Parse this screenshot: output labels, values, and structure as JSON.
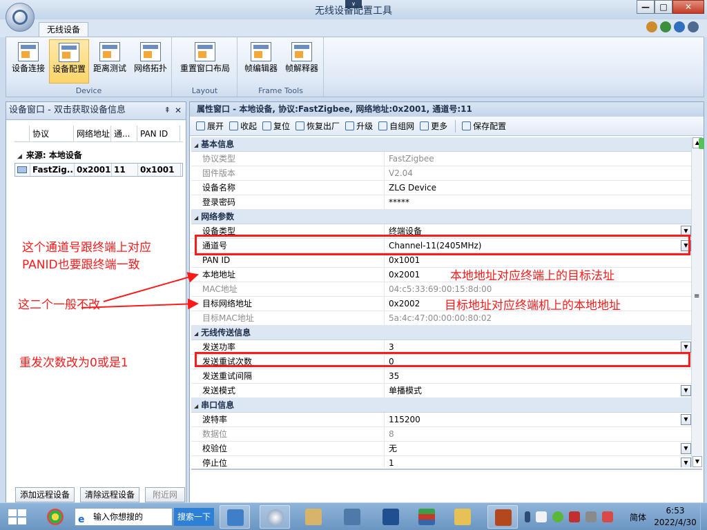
{
  "window": {
    "title": "无线设备配置工具",
    "min": "—",
    "max": "□",
    "close": "✕",
    "collapse": "∨"
  },
  "ribbon": {
    "tab": "无线设备",
    "groups": [
      {
        "label": "Device",
        "buttons": [
          "设备连接",
          "设备配置",
          "距离测试",
          "网络拓扑"
        ]
      },
      {
        "label": "Layout",
        "buttons": [
          "重置窗口布局"
        ]
      },
      {
        "label": "Frame Tools",
        "buttons": [
          "帧编辑器",
          "帧解释器"
        ]
      }
    ]
  },
  "left_panel": {
    "title": "设备窗口 - 双击获取设备信息",
    "pin": "⇞",
    "close": "✕",
    "columns": [
      "协议",
      "网络地址",
      "通...",
      "PAN ID"
    ],
    "group": "来源: 本地设备",
    "row": [
      "FastZig...",
      "0x2001",
      "11",
      "0x1001"
    ],
    "buttons": [
      "添加远程设备",
      "清除远程设备",
      "附近网"
    ]
  },
  "right_panel": {
    "title": "属性窗口 - 本地设备, 协议:FastZigbee, 网络地址:0x2001, 通道号:11",
    "toolbar": [
      "展开",
      "收起",
      "复位",
      "恢复出厂",
      "升级",
      "自组网",
      "更多",
      "保存配置"
    ],
    "sections": [
      {
        "title": "基本信息",
        "rows": [
          {
            "name": "协议类型",
            "value": "FastZigbee"
          },
          {
            "name": "固件版本",
            "value": "V2.04"
          },
          {
            "name": "设备名称",
            "value": "ZLG Device"
          },
          {
            "name": "登录密码",
            "value": "*****"
          }
        ]
      },
      {
        "title": "网络参数",
        "rows": [
          {
            "name": "设备类型",
            "value": "终端设备"
          },
          {
            "name": "通道号",
            "value": "Channel-11(2405MHz)"
          },
          {
            "name": "PAN ID",
            "value": "0x1001"
          },
          {
            "name": "本地地址",
            "value": "0x2001"
          },
          {
            "name": "MAC地址",
            "value": "04:c5:33:69:00:15:8d:00"
          },
          {
            "name": "目标网络地址",
            "value": "0x2002"
          },
          {
            "name": "目标MAC地址",
            "value": "5a:4c:47:00:00:00:80:02"
          }
        ]
      },
      {
        "title": "无线传送信息",
        "rows": [
          {
            "name": "发送功率",
            "value": "3"
          },
          {
            "name": "发送重试次数",
            "value": "0"
          },
          {
            "name": "发送重试间隔",
            "value": "35"
          },
          {
            "name": "发送模式",
            "value": "单播模式"
          }
        ]
      },
      {
        "title": "串口信息",
        "rows": [
          {
            "name": "波特率",
            "value": "115200"
          },
          {
            "name": "数据位",
            "value": "8"
          },
          {
            "name": "校验位",
            "value": "无"
          },
          {
            "name": "停止位",
            "value": "1"
          }
        ]
      }
    ]
  },
  "annotations": {
    "channel_note_1": "这个通道号跟终端上对应",
    "channel_note_2": "PANID也要跟终端一致",
    "unchanged_note": "这二个一般不改",
    "retry_note": "重发次数改为0或是1",
    "local_addr_note": "本地地址对应终端上的目标法址",
    "target_addr_note": "目标地址对应终端机上的本地地址"
  },
  "taskbar": {
    "search_placeholder": "输入你想搜的",
    "search_button": "搜索一下",
    "ime": "简体",
    "time": "6:53",
    "date": "2022/4/30"
  },
  "colors": {
    "annotation": "#ff1a1a",
    "accent": "#2e7fd6"
  }
}
